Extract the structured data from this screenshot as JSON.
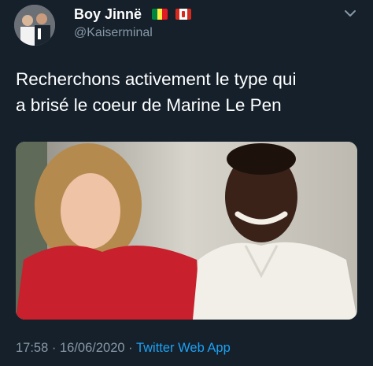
{
  "author": {
    "display_name": "Boy Jinnë",
    "handle": "@Kaiserminal",
    "flags": [
      "senegal-flag",
      "canada-flag"
    ],
    "avatar_icon": "avatar-photo"
  },
  "tweet": {
    "text": "Recherchons activement le type qui\na brisé le coeur de Marine Le Pen",
    "media_icon": "couple-photo"
  },
  "meta": {
    "time": "17:58",
    "separator1": " · ",
    "date": "16/06/2020",
    "separator2": " · ",
    "source": "Twitter Web App"
  },
  "colors": {
    "background": "#15202b",
    "text": "#ffffff",
    "secondary": "#8899a6",
    "link": "#1da1f2"
  },
  "menu_icon": "chevron-down-icon"
}
